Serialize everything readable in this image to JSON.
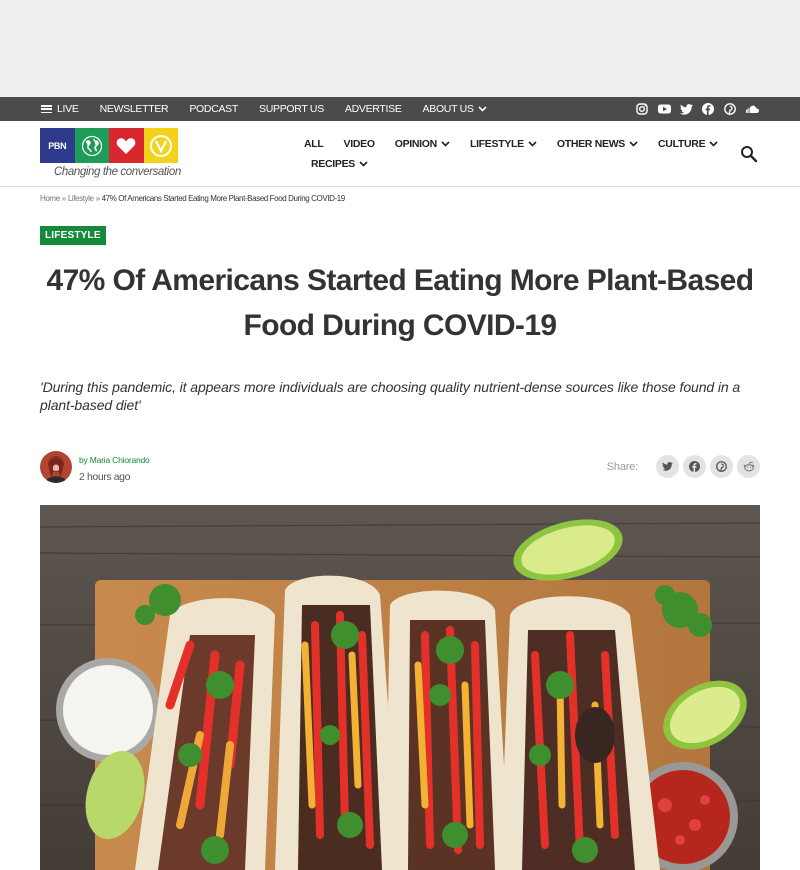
{
  "topbar": {
    "live_label": "LIVE",
    "newsletter_label": "NEWSLETTER",
    "podcast_label": "PODCAST",
    "support_label": "SUPPORT US",
    "advertise_label": "ADVERTISE",
    "about_label": "ABOUT US",
    "social_icons": [
      "instagram-icon",
      "youtube-icon",
      "twitter-icon",
      "facebook-icon",
      "pinterest-icon",
      "soundcloud-icon"
    ]
  },
  "logo": {
    "brand_text": "PBN",
    "tagline": "Changing the conversation",
    "colors": [
      "#2e3a8c",
      "#1e9c58",
      "#d8262f",
      "#f3d21a"
    ]
  },
  "mainnav": {
    "items": [
      "ALL",
      "VIDEO",
      "OPINION",
      "LIFESTYLE",
      "OTHER NEWS",
      "CULTURE",
      "RECIPES"
    ]
  },
  "breadcrumb": {
    "home": "Home",
    "section": "Lifestyle",
    "separator": "»",
    "current": "47% Of Americans Started Eating More Plant-Based Food During COVID-19"
  },
  "article": {
    "category": "LIFESTYLE",
    "title": "47% Of Americans Started Eating More Plant-Based Food During COVID-19",
    "deck": "'During this pandemic, it appears more individuals are choosing quality nutrient-dense sources like those found in a plant-based diet'",
    "by": "by",
    "author": "Maria Chiorando",
    "timestamp": "2 hours ago",
    "share_label": "Share:",
    "share_icons": [
      "twitter-icon",
      "facebook-icon",
      "pinterest-icon",
      "reddit-icon"
    ]
  },
  "colors": {
    "accent_green": "#148a3a",
    "topbar_bg": "#4b4b4b",
    "ad_bg": "#eeeeef"
  }
}
